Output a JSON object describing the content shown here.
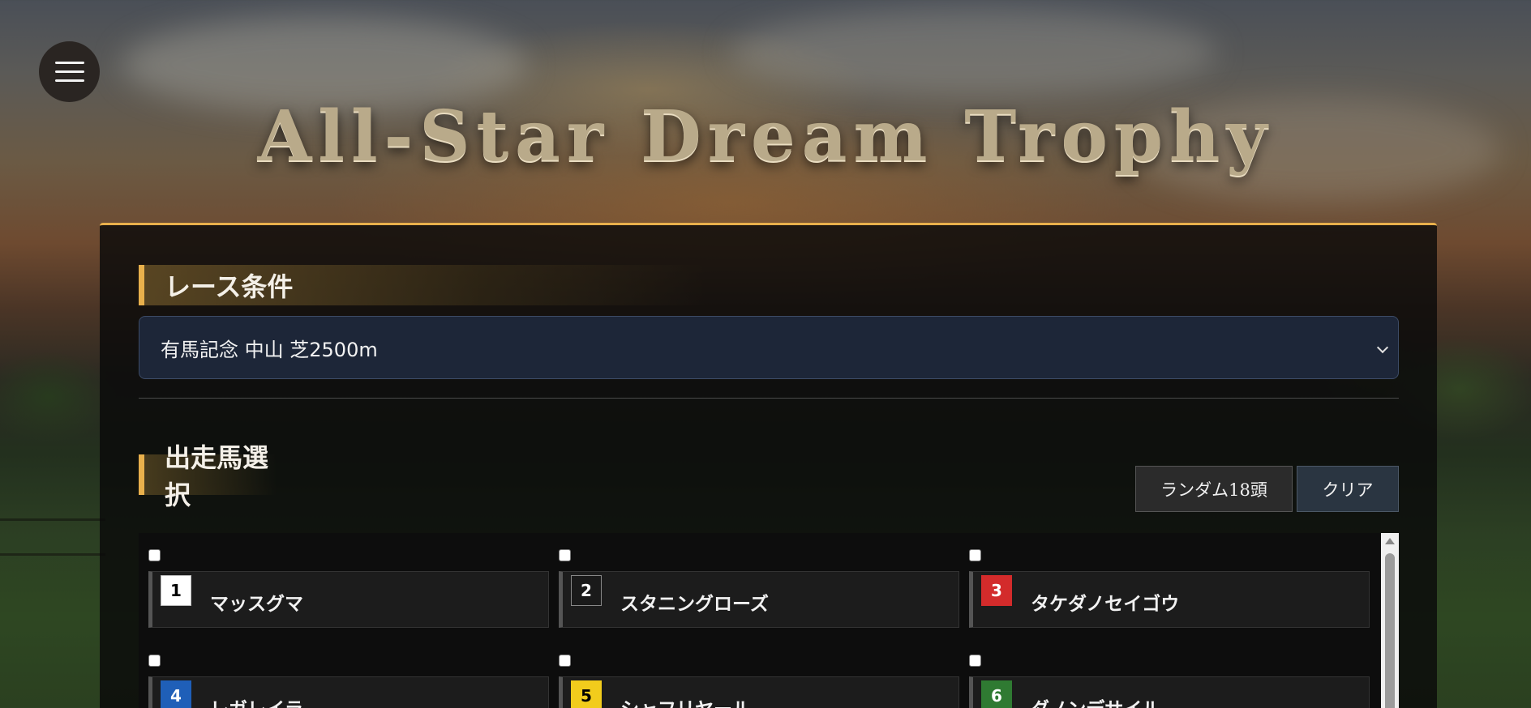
{
  "header": {
    "title": "All-Star Dream Trophy"
  },
  "race_conditions": {
    "heading": "レース条件",
    "selected_race": "有馬記念 中山 芝2500m"
  },
  "horse_selection": {
    "heading": "出走馬選択",
    "random_button": "ランダム18頭",
    "clear_button": "クリア",
    "horses": [
      {
        "gate": "1",
        "name": "マッスグマ",
        "gate_bg": "#ffffff",
        "gate_fg": "#000000",
        "checked": false
      },
      {
        "gate": "2",
        "name": "スタニングローズ",
        "gate_bg": "#1a1a1a",
        "gate_fg": "#ffffff",
        "checked": false
      },
      {
        "gate": "3",
        "name": "タケダノセイゴウ",
        "gate_bg": "#d32b2b",
        "gate_fg": "#ffffff",
        "checked": false
      },
      {
        "gate": "4",
        "name": "レガレイラ",
        "gate_bg": "#1f5fb8",
        "gate_fg": "#ffffff",
        "checked": false
      },
      {
        "gate": "5",
        "name": "シャフリヤール",
        "gate_bg": "#f2cc1c",
        "gate_fg": "#000000",
        "checked": false
      },
      {
        "gate": "6",
        "name": "ダノンデサイル",
        "gate_bg": "#2f7a32",
        "gate_fg": "#ffffff",
        "checked": false
      }
    ]
  },
  "colors": {
    "accent": "#e8b04c",
    "select_bg": "#1d2638"
  },
  "icons": {
    "menu": "hamburger-menu-icon",
    "dropdown": "chevron-down-icon",
    "scroll_up": "arrow-up-icon"
  }
}
